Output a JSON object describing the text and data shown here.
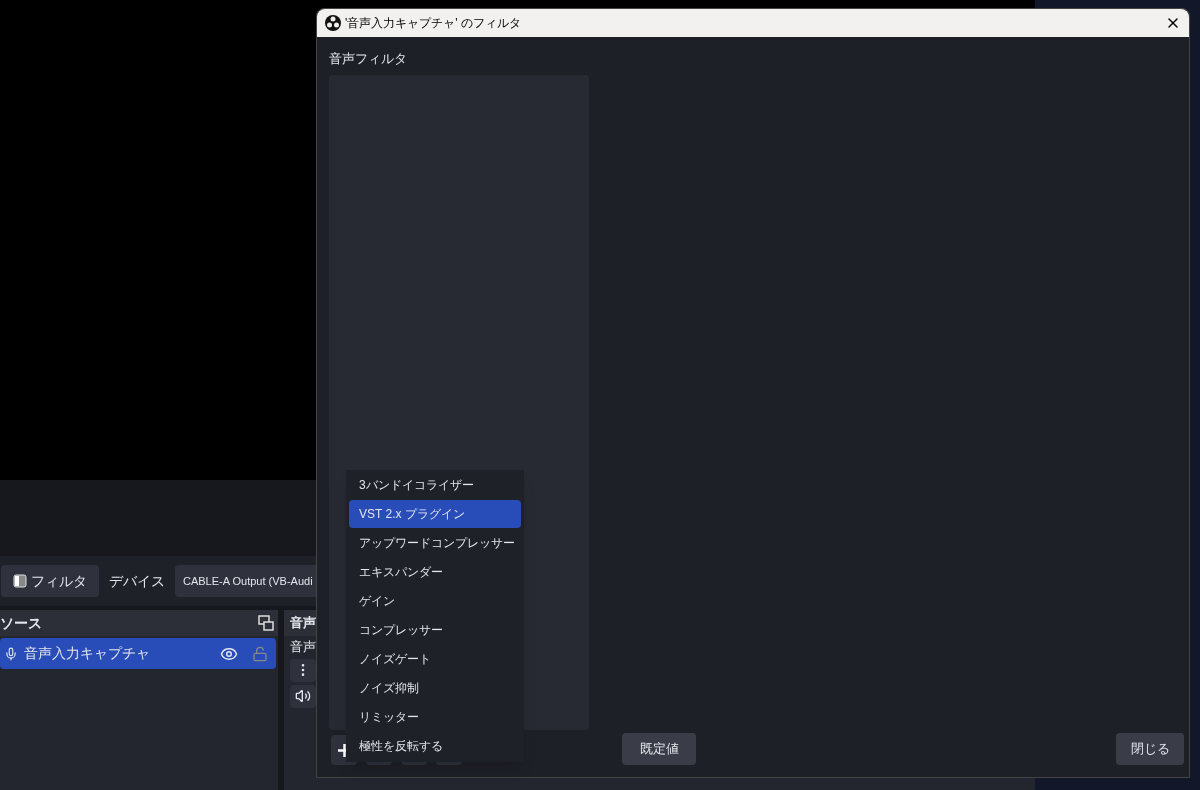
{
  "toolbar": {
    "filter_button": "フィルタ",
    "device_label": "デバイス",
    "device_value": "CABLE-A Output (VB-Audi"
  },
  "sources": {
    "title": "ソース",
    "items": [
      {
        "name": "音声入力キャプチャ",
        "selected": true,
        "visible": true,
        "locked": false
      }
    ]
  },
  "mixer": {
    "title": "音声",
    "channel": "音声"
  },
  "dialog": {
    "title": "'音声入力キャプチャ' のフィルタ",
    "section_label": "音声フィルタ",
    "menu": [
      {
        "label": "3バンドイコライザー",
        "selected": false
      },
      {
        "label": "VST 2.x プラグイン",
        "selected": true
      },
      {
        "label": "アップワードコンプレッサー",
        "selected": false
      },
      {
        "label": "エキスパンダー",
        "selected": false
      },
      {
        "label": "ゲイン",
        "selected": false
      },
      {
        "label": "コンプレッサー",
        "selected": false
      },
      {
        "label": "ノイズゲート",
        "selected": false
      },
      {
        "label": "ノイズ抑制",
        "selected": false
      },
      {
        "label": "リミッター",
        "selected": false
      },
      {
        "label": "極性を反転する",
        "selected": false
      }
    ],
    "defaults_button": "既定値",
    "close_button": "閉じる"
  }
}
